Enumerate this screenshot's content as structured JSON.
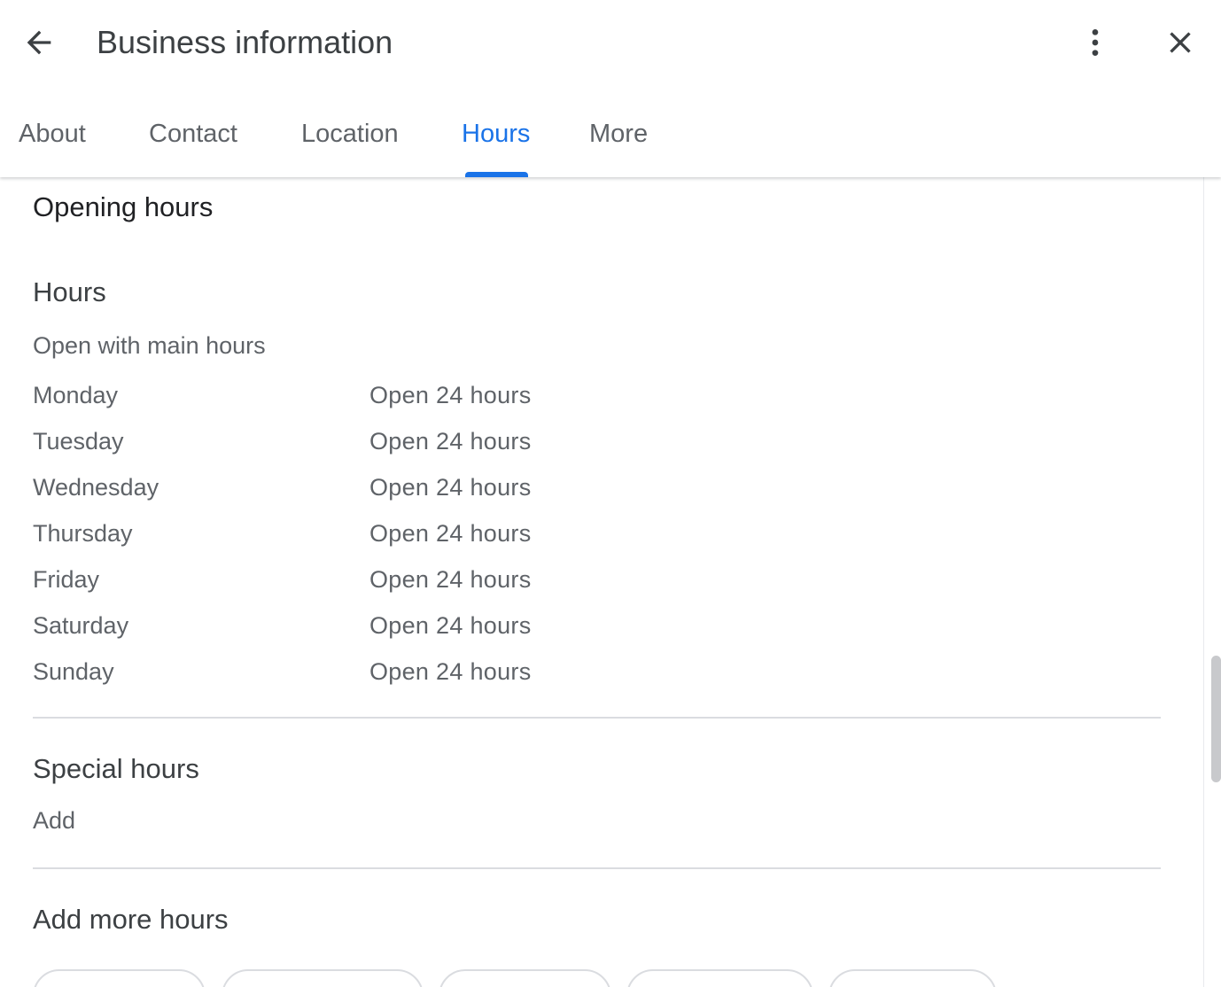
{
  "header": {
    "title": "Business information"
  },
  "tabs": [
    {
      "label": "About",
      "active": false
    },
    {
      "label": "Contact",
      "active": false
    },
    {
      "label": "Location",
      "active": false
    },
    {
      "label": "Hours",
      "active": true
    },
    {
      "label": "More",
      "active": false
    }
  ],
  "icons": {
    "back": "arrow-back-icon",
    "menu": "more-vert-icon",
    "close": "close-icon"
  },
  "colors": {
    "accent": "#1a73e8",
    "text_primary": "#202124",
    "text_secondary": "#5f6368",
    "divider": "#dadce0"
  },
  "opening_hours": {
    "section_title": "Opening hours",
    "hours_title": "Hours",
    "status": "Open with main hours",
    "days": [
      {
        "day": "Monday",
        "hours": "Open 24 hours"
      },
      {
        "day": "Tuesday",
        "hours": "Open 24 hours"
      },
      {
        "day": "Wednesday",
        "hours": "Open 24 hours"
      },
      {
        "day": "Thursday",
        "hours": "Open 24 hours"
      },
      {
        "day": "Friday",
        "hours": "Open 24 hours"
      },
      {
        "day": "Saturday",
        "hours": "Open 24 hours"
      },
      {
        "day": "Sunday",
        "hours": "Open 24 hours"
      }
    ]
  },
  "special_hours": {
    "title": "Special hours",
    "add_label": "Add"
  },
  "add_more_hours": {
    "title": "Add more hours"
  }
}
